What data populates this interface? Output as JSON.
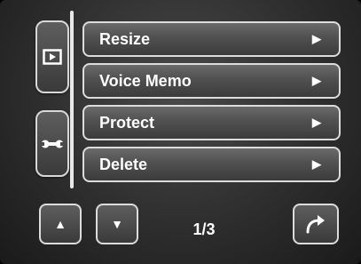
{
  "tabs": [
    {
      "name": "playback",
      "icon": "playback-icon"
    },
    {
      "name": "setup",
      "icon": "wrench-icon"
    }
  ],
  "menu": {
    "items": [
      {
        "label": "Resize",
        "arrow": "▶"
      },
      {
        "label": "Voice Memo",
        "arrow": "▶"
      },
      {
        "label": "Protect",
        "arrow": "▶"
      },
      {
        "label": "Delete",
        "arrow": "▶"
      }
    ]
  },
  "nav": {
    "up_glyph": "▲",
    "down_glyph": "▼",
    "page_indicator": "1/3",
    "return_icon": "return-arrow-icon"
  },
  "colors": {
    "background": "#333333",
    "button_border": "#dcdcdc",
    "text": "#ffffff"
  }
}
